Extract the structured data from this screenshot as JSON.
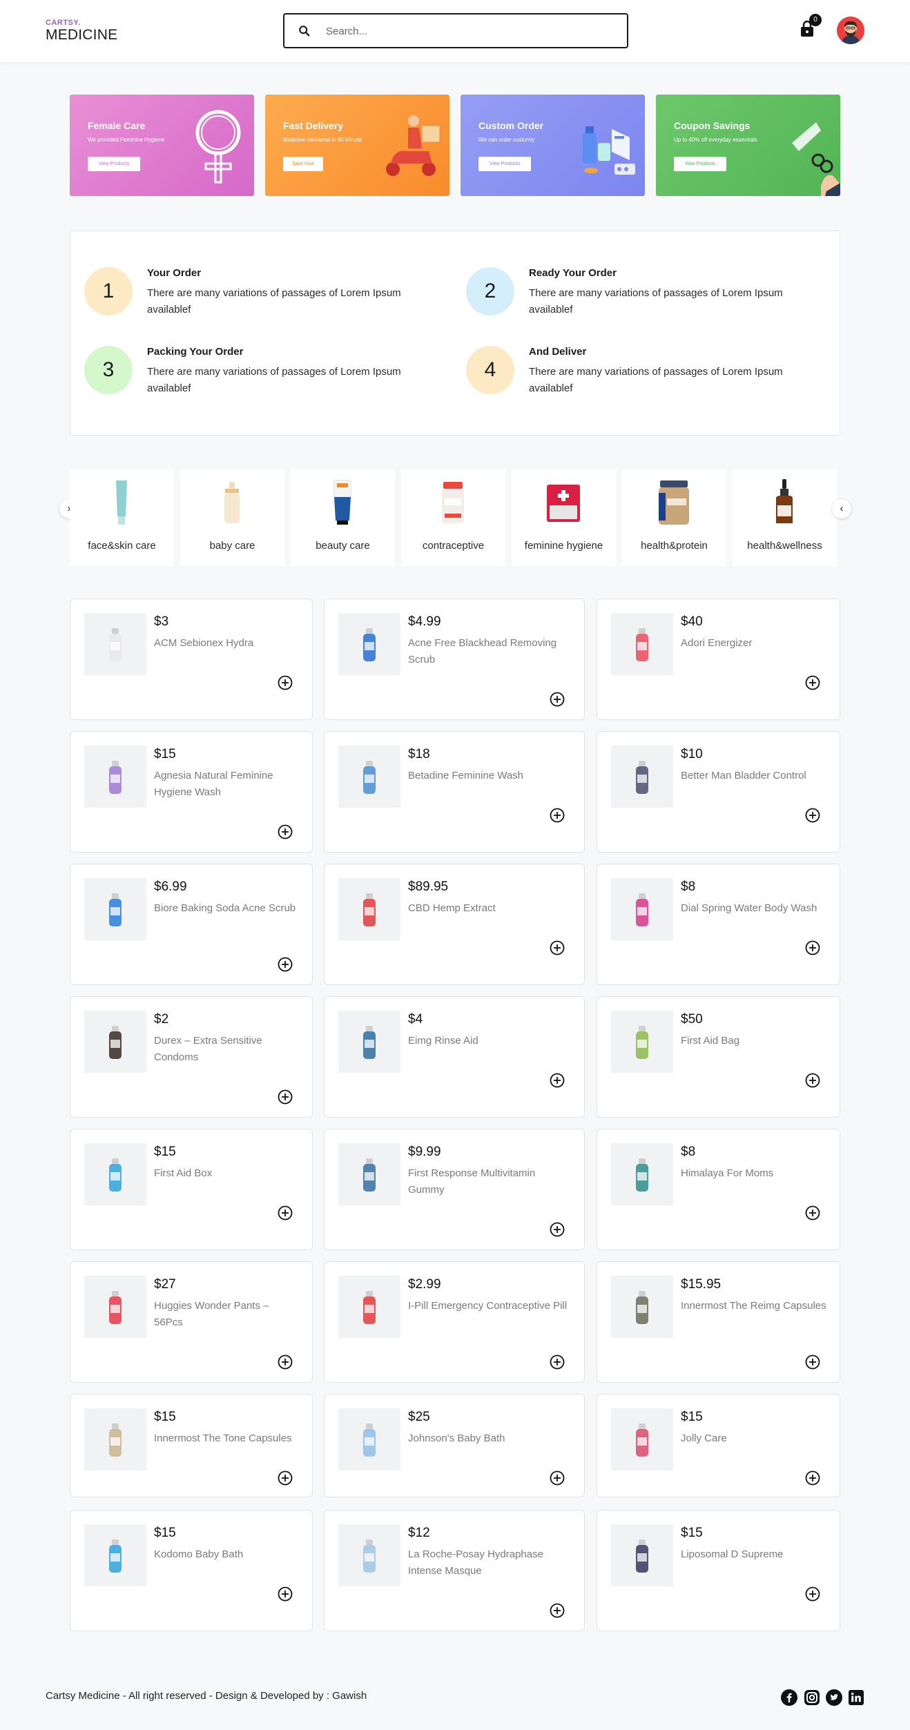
{
  "header": {
    "logo_top": "CARTSY.",
    "logo_bottom": "MEDICINE",
    "search_placeholder": "Search...",
    "cart_count": "0"
  },
  "banners": [
    {
      "title": "Female Care",
      "subtitle": "We provided Feminine Hygiene",
      "button": "View Products",
      "color": "#e17bd0"
    },
    {
      "title": "Fast Delivery",
      "subtitle": "Medicine Delivered in 90 Minute",
      "button": "Save Now",
      "color": "#fb9a3c"
    },
    {
      "title": "Custom Order",
      "subtitle": "We can order customly",
      "button": "View Products",
      "color": "#8993f2"
    },
    {
      "title": "Coupon Savings",
      "subtitle": "Up to 40% off everyday essentials",
      "button": "View Products",
      "color": "#5fbe62"
    }
  ],
  "steps": [
    {
      "number": "1",
      "title": "Your Order",
      "description": "There are many variations of passages of Lorem Ipsum availablef",
      "color": "#fde9c3"
    },
    {
      "number": "2",
      "title": "Ready Your Order",
      "description": "There are many variations of passages of Lorem Ipsum availablef",
      "color": "#d4effb"
    },
    {
      "number": "3",
      "title": "Packing Your Order",
      "description": "There are many variations of passages of Lorem Ipsum availablef",
      "color": "#d5f7cc"
    },
    {
      "number": "4",
      "title": "And Deliver",
      "description": "There are many variations of passages of Lorem Ipsum availablef",
      "color": "#fde9c3"
    }
  ],
  "categories": [
    {
      "label": "face&skin care"
    },
    {
      "label": "baby care"
    },
    {
      "label": "beauty care"
    },
    {
      "label": "contraceptive"
    },
    {
      "label": "feminine hygiene"
    },
    {
      "label": "health&protein"
    },
    {
      "label": "health&wellness"
    }
  ],
  "products": [
    {
      "price": "$3",
      "name": "ACM Sebionex Hydra"
    },
    {
      "price": "$4.99",
      "name": "Acne Free Blackhead Removing Scrub"
    },
    {
      "price": "$40",
      "name": "Adori Energizer"
    },
    {
      "price": "$15",
      "name": "Agnesia Natural Feminine Hygiene Wash"
    },
    {
      "price": "$18",
      "name": "Betadine Feminine Wash"
    },
    {
      "price": "$10",
      "name": "Better Man Bladder Control"
    },
    {
      "price": "$6.99",
      "name": "Biore Baking Soda Acne Scrub"
    },
    {
      "price": "$89.95",
      "name": "CBD Hemp Extract"
    },
    {
      "price": "$8",
      "name": "Dial Spring Water Body Wash"
    },
    {
      "price": "$2",
      "name": "Durex – Extra Sensitive Condoms"
    },
    {
      "price": "$4",
      "name": "Eimg Rinse Aid"
    },
    {
      "price": "$50",
      "name": "First Aid Bag"
    },
    {
      "price": "$15",
      "name": "First Aid Box"
    },
    {
      "price": "$9.99",
      "name": "First Response Multivitamin Gummy"
    },
    {
      "price": "$8",
      "name": "Himalaya For Moms"
    },
    {
      "price": "$27",
      "name": "Huggies Wonder Pants – 56Pcs"
    },
    {
      "price": "$2.99",
      "name": "I-Pill Emergency Contraceptive Pill"
    },
    {
      "price": "$15.95",
      "name": "Innermost The Reimg Capsules"
    },
    {
      "price": "$15",
      "name": "Innermost The Tone Capsules"
    },
    {
      "price": "$25",
      "name": "Johnson's Baby Bath"
    },
    {
      "price": "$15",
      "name": "Jolly Care"
    },
    {
      "price": "$15",
      "name": "Kodomo Baby Bath"
    },
    {
      "price": "$12",
      "name": "La Roche-Posay Hydraphase Intense Masque"
    },
    {
      "price": "$15",
      "name": "Liposomal D Supreme"
    }
  ],
  "footer": {
    "text": "Cartsy Medicine - All right reserved - Design & Developed by : Gawish",
    "social": [
      "facebook-icon",
      "instagram-icon",
      "twitter-icon",
      "linkedin-icon"
    ]
  }
}
